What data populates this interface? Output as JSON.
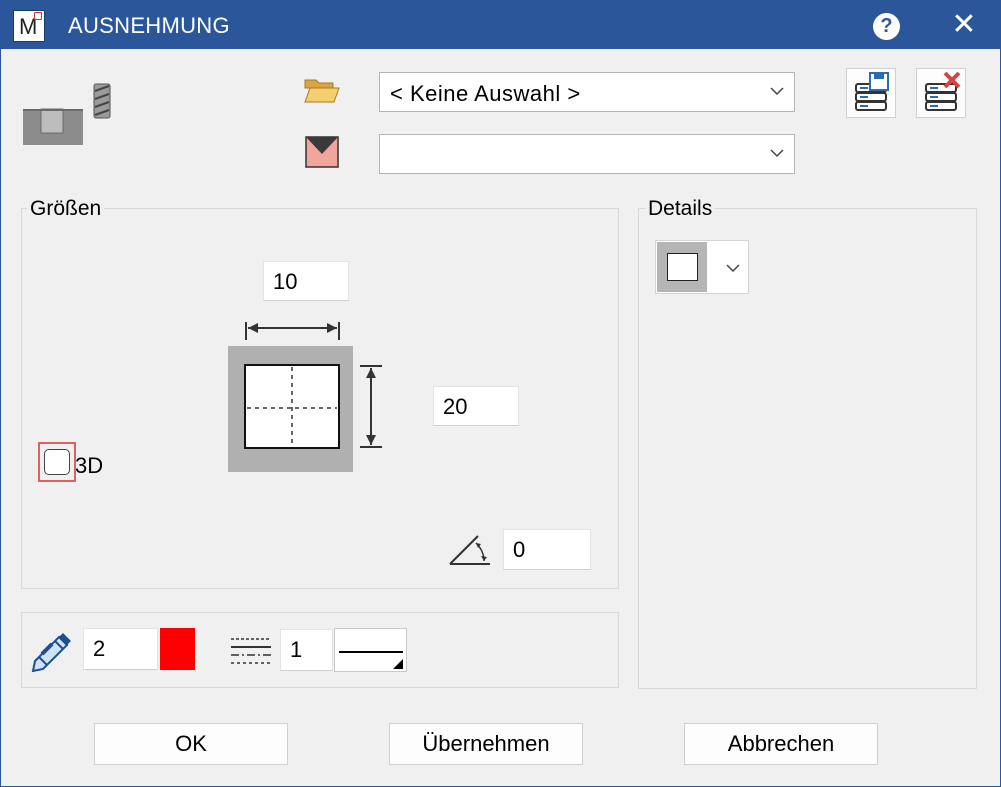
{
  "window": {
    "title": "AUSNEHMUNG",
    "help_glyph": "?",
    "close_glyph": "✕",
    "app_icon_letter": "M"
  },
  "top": {
    "folder_combo_value": "< Keine Auswahl >",
    "filter_combo_value": ""
  },
  "groups": {
    "sizes_title": "Größen",
    "details_title": "Details"
  },
  "sizes": {
    "width_value": "10",
    "height_value": "20",
    "angle_value": "0",
    "checkbox_3d_label": "3D",
    "checkbox_3d_checked": false
  },
  "pen": {
    "pen_value": "2",
    "color": "#ff0000",
    "linetype_value": "1"
  },
  "buttons": {
    "ok": "OK",
    "apply": "Übernehmen",
    "cancel": "Abbrechen"
  },
  "icons": {
    "folder": "folder-open-icon",
    "filter": "filter-icon",
    "save_db": "database-save-icon",
    "delete_db": "database-delete-icon",
    "pen": "pencil-icon",
    "linetype": "line-type-icon",
    "angle": "angle-icon",
    "mill": "milling-tool-icon"
  }
}
